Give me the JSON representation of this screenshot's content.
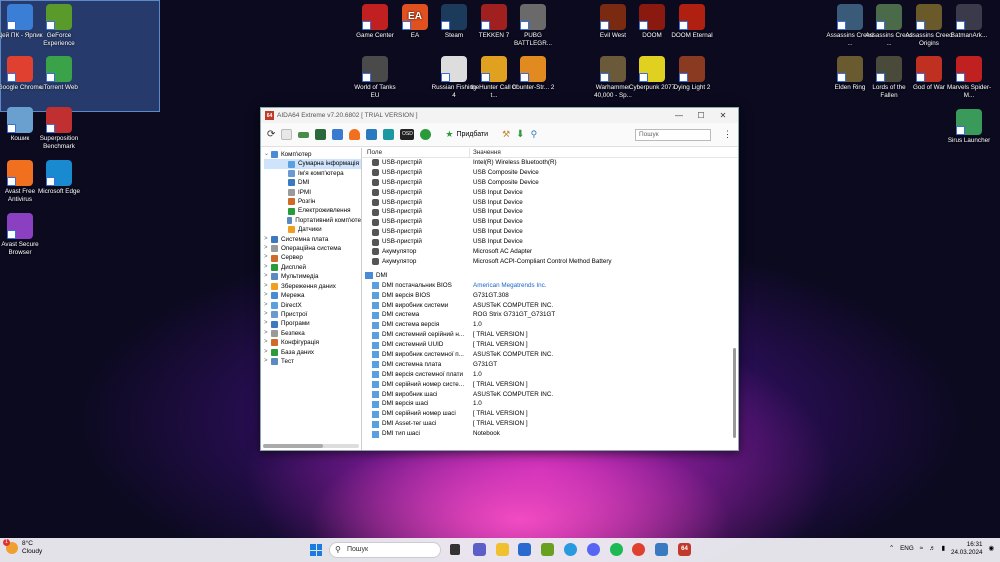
{
  "desktop_icons": [
    {
      "label": "Цей ПК - Ярлик",
      "icon": "this-pc-icon",
      "color": "#3a7fd5",
      "glyph": ""
    },
    {
      "label": "GeForce Experience",
      "icon": "geforce-icon",
      "color": "#5a9a2a",
      "glyph": ""
    },
    {
      "label": "Google Chrome",
      "icon": "chrome-icon",
      "color": "#e04030",
      "glyph": ""
    },
    {
      "label": "uTorrent Web",
      "icon": "utorrent-icon",
      "color": "#3aa34a",
      "glyph": ""
    },
    {
      "label": "Кошик",
      "icon": "recycle-bin-icon",
      "color": "#6aa0d0",
      "glyph": ""
    },
    {
      "label": "Superposition Benchmark",
      "icon": "superposition-icon",
      "color": "#c03030",
      "glyph": ""
    },
    {
      "label": "Avast Free Antivirus",
      "icon": "avast-icon",
      "color": "#f07020",
      "glyph": ""
    },
    {
      "label": "Microsoft Edge",
      "icon": "edge-icon",
      "color": "#1a8ad0",
      "glyph": ""
    },
    {
      "label": "Avast Secure Browser",
      "icon": "avast-browser-icon",
      "color": "#8a40c0",
      "glyph": ""
    },
    {
      "label": "Game Center",
      "icon": "game-center-icon",
      "color": "#c02020",
      "glyph": ""
    },
    {
      "label": "EA",
      "icon": "ea-icon",
      "color": "#e05020",
      "glyph": "EA"
    },
    {
      "label": "Steam",
      "icon": "steam-icon",
      "color": "#1b3a5c",
      "glyph": ""
    },
    {
      "label": "TEKKEN 7",
      "icon": "tekken-icon",
      "color": "#a02020",
      "glyph": ""
    },
    {
      "label": "PUBG BATTLEGR...",
      "icon": "pubg-icon",
      "color": "#6a6a6a",
      "glyph": ""
    },
    {
      "label": "Evil West",
      "icon": "evil-west-icon",
      "color": "#7a2a10",
      "glyph": ""
    },
    {
      "label": "DOOM",
      "icon": "doom-icon",
      "color": "#8a1a10",
      "glyph": ""
    },
    {
      "label": "DOOM Eternal",
      "icon": "doom-eternal-icon",
      "color": "#b02010",
      "glyph": ""
    },
    {
      "label": "World of Tanks EU",
      "icon": "wot-icon",
      "color": "#4a4a4a",
      "glyph": ""
    },
    {
      "label": "Russian Fishing 4",
      "icon": "fishing-icon",
      "color": "#dddddd",
      "glyph": ""
    },
    {
      "label": "theHunter Call of t...",
      "icon": "hunter-icon",
      "color": "#e0a020",
      "glyph": ""
    },
    {
      "label": "Counter-Str... 2",
      "icon": "cs2-icon",
      "color": "#e08a20",
      "glyph": ""
    },
    {
      "label": "Warhammer 40,000 - Sp...",
      "icon": "warhammer-icon",
      "color": "#6a5a3a",
      "glyph": ""
    },
    {
      "label": "Cyberpunk 2077",
      "icon": "cyberpunk-icon",
      "color": "#e0d020",
      "glyph": ""
    },
    {
      "label": "Dying Light 2",
      "icon": "dying-light-icon",
      "color": "#8a3a20",
      "glyph": ""
    },
    {
      "label": "Assassins Creed ...",
      "icon": "ac1-icon",
      "color": "#3a5a7a",
      "glyph": ""
    },
    {
      "label": "Assassins Creed ...",
      "icon": "ac2-icon",
      "color": "#4a6a4a",
      "glyph": ""
    },
    {
      "label": "Assassins Creed Origins",
      "icon": "ac-origins-icon",
      "color": "#6a5a2a",
      "glyph": ""
    },
    {
      "label": "BatmanArk...",
      "icon": "batman-icon",
      "color": "#3a3a4a",
      "glyph": ""
    },
    {
      "label": "Elden Ring",
      "icon": "elden-ring-icon",
      "color": "#6a5a30",
      "glyph": ""
    },
    {
      "label": "Lords of the Fallen",
      "icon": "lords-icon",
      "color": "#4a4a3a",
      "glyph": ""
    },
    {
      "label": "God of War",
      "icon": "god-of-war-icon",
      "color": "#c03020",
      "glyph": ""
    },
    {
      "label": "Marvels Spider-M...",
      "icon": "spiderman-icon",
      "color": "#c02020",
      "glyph": ""
    },
    {
      "label": "Sirus Launcher",
      "icon": "sirus-icon",
      "color": "#3a9a5a",
      "glyph": ""
    }
  ],
  "window": {
    "title": "AIDA64 Extreme v7.20.6802  [ TRIAL VERSION ]",
    "app_badge": "64",
    "report_label": "Придбати",
    "search_placeholder": "Пошук",
    "col_field": "Поле",
    "col_value": "Значення"
  },
  "tree": {
    "root": "Комп'ютер",
    "children": [
      "Сумарна інформація",
      "Ім'я комп'ютера",
      "DMI",
      "IPMI",
      "Розгін",
      "Електроживлення",
      "Портативний комп'юте",
      "Датчики"
    ],
    "sections": [
      "Системна плата",
      "Операційна система",
      "Сервер",
      "Дисплей",
      "Мультимедіа",
      "Збереження даних",
      "Мережа",
      "DirectX",
      "Пристрої",
      "Програми",
      "Безпека",
      "Конфігурація",
      "База даних",
      "Тест"
    ]
  },
  "rows_top": [
    {
      "field": "USB-пристрій",
      "value": "Intel(R) Wireless Bluetooth(R)",
      "icon": "usb-icon"
    },
    {
      "field": "USB-пристрій",
      "value": "USB Composite Device",
      "icon": "usb-icon"
    },
    {
      "field": "USB-пристрій",
      "value": "USB Composite Device",
      "icon": "usb-icon"
    },
    {
      "field": "USB-пристрій",
      "value": "USB Input Device",
      "icon": "usb-icon"
    },
    {
      "field": "USB-пристрій",
      "value": "USB Input Device",
      "icon": "usb-icon"
    },
    {
      "field": "USB-пристрій",
      "value": "USB Input Device",
      "icon": "usb-icon"
    },
    {
      "field": "USB-пристрій",
      "value": "USB Input Device",
      "icon": "usb-icon"
    },
    {
      "field": "USB-пристрій",
      "value": "USB Input Device",
      "icon": "usb-icon"
    },
    {
      "field": "USB-пристрій",
      "value": "USB Input Device",
      "icon": "usb-icon"
    },
    {
      "field": "Акумулятор",
      "value": "Microsoft AC Adapter",
      "icon": "battery-icon"
    },
    {
      "field": "Акумулятор",
      "value": "Microsoft ACPI-Compliant Control Method Battery",
      "icon": "battery-icon"
    }
  ],
  "dmi_section": "DMI",
  "rows_dmi": [
    {
      "field": "DMI постачальник BIOS",
      "value": "American Megatrends Inc.",
      "link": true
    },
    {
      "field": "DMI версія BIOS",
      "value": "G731GT.308"
    },
    {
      "field": "DMI виробник системи",
      "value": "ASUSTeK COMPUTER INC."
    },
    {
      "field": "DMI система",
      "value": "ROG Strix G731GT_G731GT"
    },
    {
      "field": "DMI система версія",
      "value": "1.0"
    },
    {
      "field": "DMI системний серійний н...",
      "value": "[ TRIAL VERSION ]"
    },
    {
      "field": "DMI системний UUID",
      "value": "[ TRIAL VERSION ]"
    },
    {
      "field": "DMI виробник системної п...",
      "value": "ASUSTeK COMPUTER INC."
    },
    {
      "field": "DMI системна плата",
      "value": "G731GT"
    },
    {
      "field": "DMI версія системної плати",
      "value": "1.0"
    },
    {
      "field": "DMI серійний номер систе...",
      "value": "[ TRIAL VERSION ]"
    },
    {
      "field": "DMI виробник шасі",
      "value": "ASUSTeK COMPUTER INC."
    },
    {
      "field": "DMI версія шасі",
      "value": "1.0"
    },
    {
      "field": "DMI серійний номер шасі",
      "value": "[ TRIAL VERSION ]"
    },
    {
      "field": "DMI Asset-тег шасі",
      "value": "[ TRIAL VERSION ]"
    },
    {
      "field": "DMI тип шасі",
      "value": "Notebook"
    }
  ],
  "taskbar": {
    "weather_temp": "8°C",
    "weather_desc": "Cloudy",
    "weather_badge": "1",
    "search_placeholder": "Пошук",
    "lang": "ENG",
    "time": "16:31",
    "date": "24.03.2024",
    "aida_badge": "64"
  }
}
